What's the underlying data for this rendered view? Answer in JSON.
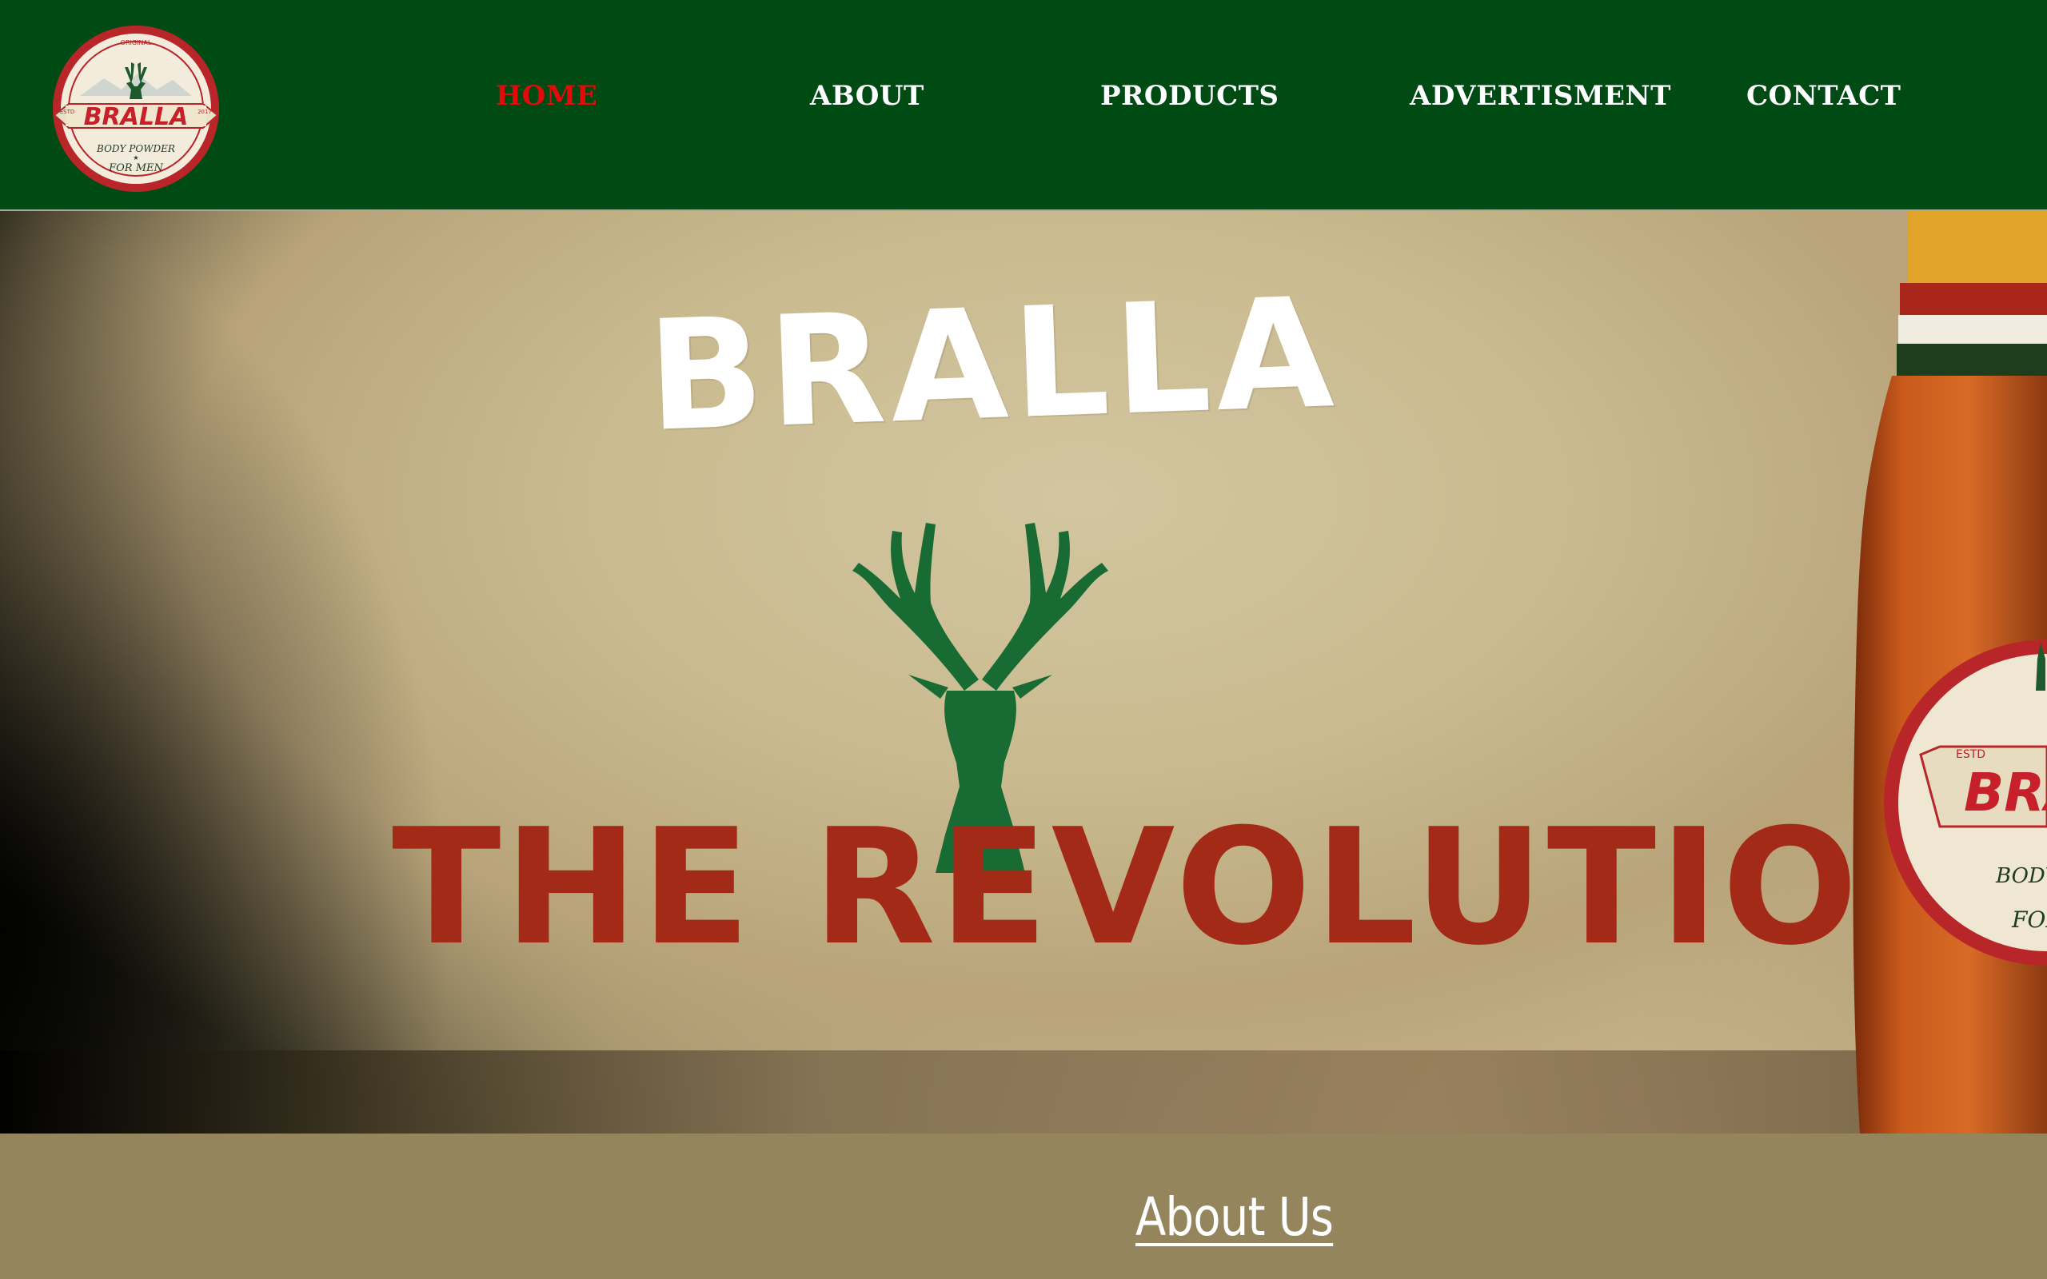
{
  "logo": {
    "original": "ORIGINAL",
    "brand": "BRALLA",
    "estd_left": "ESTD",
    "estd_right": "2017",
    "line1": "BODY POWDER",
    "line2": "FOR MEN"
  },
  "nav": {
    "items": [
      {
        "label": "HOME",
        "active": true
      },
      {
        "label": "ABOUT",
        "active": false
      },
      {
        "label": "PRODUCTS",
        "active": false
      },
      {
        "label": "ADVERTISMENT",
        "active": false
      },
      {
        "label": "CONTACT",
        "active": false
      }
    ],
    "active_color": "#e10b0b",
    "text_color": "#ffffff",
    "background": "#004a13"
  },
  "hero": {
    "brand": "BRALLA",
    "tagline": "THE REVOLUTION",
    "brand_color": "#ffffff",
    "tagline_color": "#a42a18",
    "stag_color": "#176b33",
    "bottle_label": {
      "brand": "BRALLA",
      "estd": "ESTD",
      "line1": "BODY",
      "line2": "FOR"
    }
  },
  "about": {
    "title": "About Us",
    "background": "#95855d"
  }
}
